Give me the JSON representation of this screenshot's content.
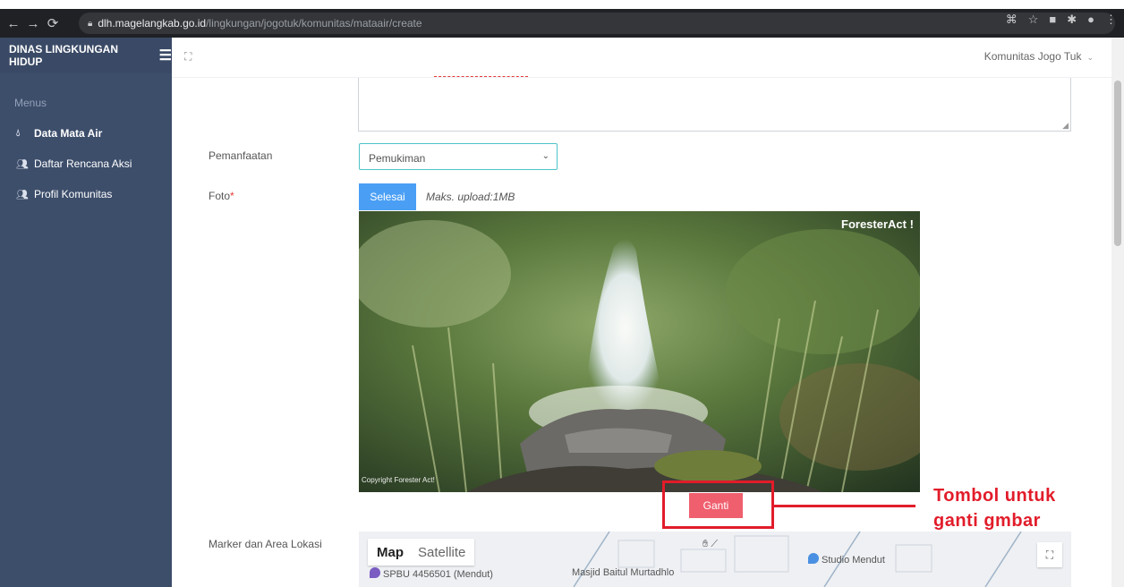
{
  "browser": {
    "url_host": "dlh.magelangkab.go.id",
    "url_path": "/lingkungan/jogotuk/komunitas/mataair/create",
    "back_icon": "arrow-left",
    "forward_icon": "arrow-right",
    "reload_icon": "reload",
    "lock_icon": "lock"
  },
  "sidebar": {
    "brand": "DINAS LINGKUNGAN HIDUP",
    "section_label": "Menus",
    "items": [
      {
        "label": "Data Mata Air",
        "icon": "droplet-icon"
      },
      {
        "label": "Daftar Rencana Aksi",
        "icon": "users-icon"
      },
      {
        "label": "Profil Komunitas",
        "icon": "users-icon"
      }
    ]
  },
  "topbar": {
    "user_name": "Komunitas Jogo Tuk"
  },
  "form": {
    "pemanfaatan_label": "Pemanfaatan",
    "pemanfaatan_value": "Pemukiman",
    "foto_label": "Foto",
    "required_mark": "*",
    "selesai_button": "Selesai",
    "upload_note": "Maks. upload:1MB",
    "photo_brand": "ForesterAct !",
    "photo_copyright": "Copyright Forester Act!",
    "ganti_button": "Ganti",
    "marker_label": "Marker dan Area Lokasi"
  },
  "annotation": {
    "callout_line1": "Tombol untuk",
    "callout_line2": "ganti gmbar",
    "color": "#e21c2a"
  },
  "map": {
    "tab_map": "Map",
    "tab_satellite": "Satellite",
    "poi_1": "SPBU 4456501 (Mendut)",
    "poi_2": "Masjid Baitul Murtadhlo",
    "poi_3": "Studio Mendut"
  },
  "colors": {
    "sidebar_bg": "#3d4e6b",
    "primary_button": "#4a9ff5",
    "danger_button": "#ef5f6e"
  }
}
